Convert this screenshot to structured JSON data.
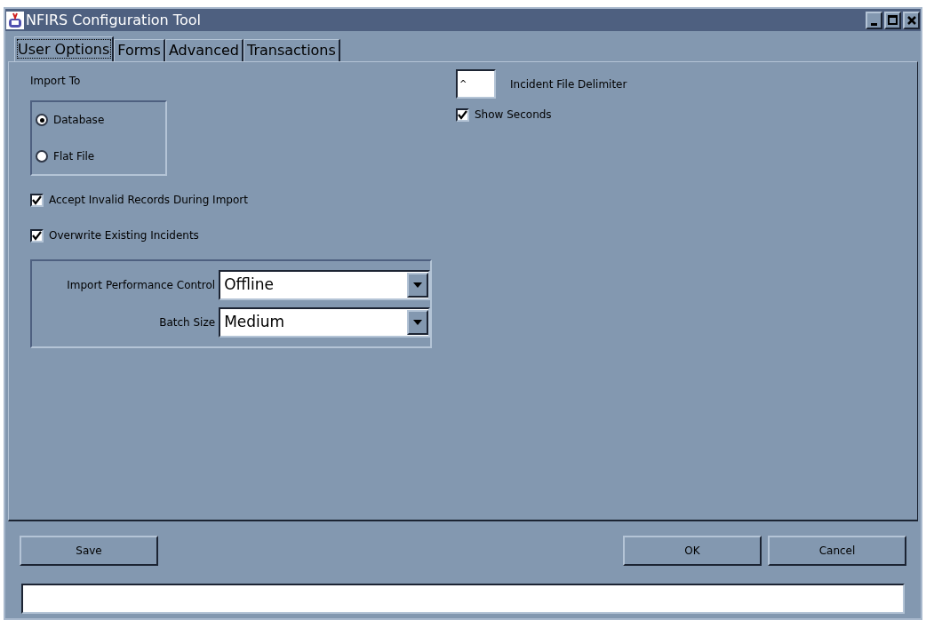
{
  "window": {
    "title": "NFIRS Configuration Tool"
  },
  "tabs": [
    {
      "label": "User Options",
      "selected": true
    },
    {
      "label": "Forms",
      "selected": false
    },
    {
      "label": "Advanced",
      "selected": false
    },
    {
      "label": "Transactions",
      "selected": false
    }
  ],
  "import_to": {
    "label": "Import To",
    "options": [
      {
        "label": "Database",
        "selected": true
      },
      {
        "label": "Flat File",
        "selected": false
      }
    ]
  },
  "checkboxes": [
    {
      "label": "Accept Invalid Records During Import",
      "checked": true
    },
    {
      "label": "Overwrite Existing Incidents",
      "checked": true
    }
  ],
  "performance": [
    {
      "label": "Import Performance Control",
      "value": "Offline"
    },
    {
      "label": "Batch Size",
      "value": "Medium"
    }
  ],
  "delimiter": {
    "value": "^",
    "label": "Incident File Delimiter"
  },
  "show_seconds": {
    "label": "Show Seconds",
    "checked": true
  },
  "buttons": {
    "save": "Save",
    "ok": "OK",
    "cancel": "Cancel"
  }
}
